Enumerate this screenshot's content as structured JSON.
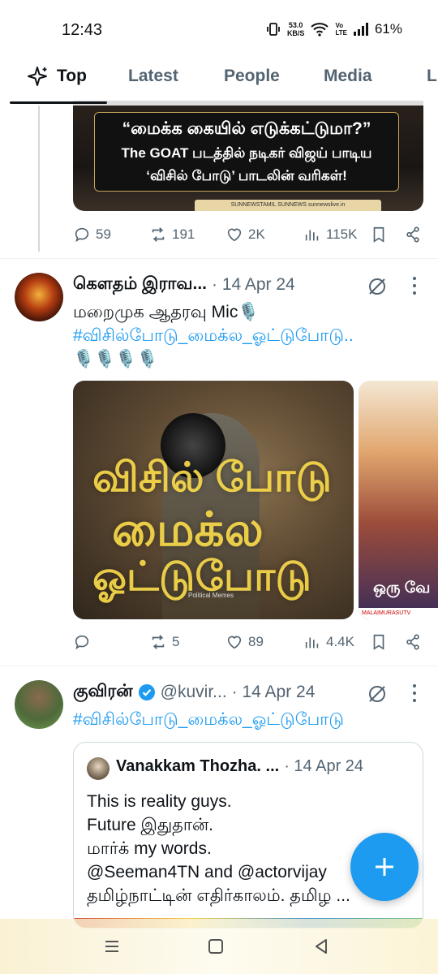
{
  "status_bar": {
    "time": "12:43",
    "net_speed_value": "53.0",
    "net_speed_unit": "KB/S",
    "volte_top": "Vo",
    "volte_bottom": "LTE",
    "battery": "61%"
  },
  "tabs": [
    {
      "label": "Top",
      "active": true
    },
    {
      "label": "Latest",
      "active": false
    },
    {
      "label": "People",
      "active": false
    },
    {
      "label": "Media",
      "active": false
    },
    {
      "label": "L",
      "active": false
    }
  ],
  "tweet1": {
    "card_line1": "“மைக்க கையில் எடுக்கட்டுமா?”",
    "card_line2": "The GOAT படத்தில் நடிகர் விஜய் பாடிய",
    "card_line3": "‘விசில் போடு’ பாடலின் வரிகள்!",
    "card_footer": "SUNNEWSTAMIL  SUNNEWS  sunnewslive.in",
    "replies": "59",
    "reposts": "191",
    "likes": "2K",
    "views": "115K"
  },
  "tweet2": {
    "name": "கௌதம் இராவ...",
    "date": "· 14 Apr 24",
    "text_line1": "மறைமுக ஆதரவு Mic🎙️",
    "hashtag": "#விசில்போடு_மைக்ல_ஓட்டுபோடு..",
    "emoji_line": "🎙️🎙️🎙️🎙️",
    "image1_text_top": "விசில் போடு",
    "image1_text_mid": "மைக்ல",
    "image1_text_bottom": "ஓட்டுபோடு",
    "image1_watermark": "Political Memes",
    "image2_text": "ஒரு வே",
    "image2_banner": "MALAIMURASUTV",
    "replies": "",
    "reposts": "5",
    "likes": "89",
    "views": "4.4K"
  },
  "tweet3": {
    "name": "குவிரன்",
    "handle": "@kuvir...",
    "date": "· 14 Apr 24",
    "hashtag": "#விசில்போடு_மைக்ல_ஓட்டுபோடு",
    "quote": {
      "name": "Vanakkam Thozha. ...",
      "date": "· 14 Apr 24",
      "line1": "This is reality guys.",
      "line2": "Future இதுதான்.",
      "line3": "மார்க் my words.",
      "line4": "@Seeman4TN and @actorvijay",
      "line5": "தமிழ்நாட்டின் எதிர்காலம். தமிழ ..."
    }
  },
  "colors": {
    "accent": "#1d9bf0",
    "text": "#0f1419",
    "muted": "#536471"
  }
}
